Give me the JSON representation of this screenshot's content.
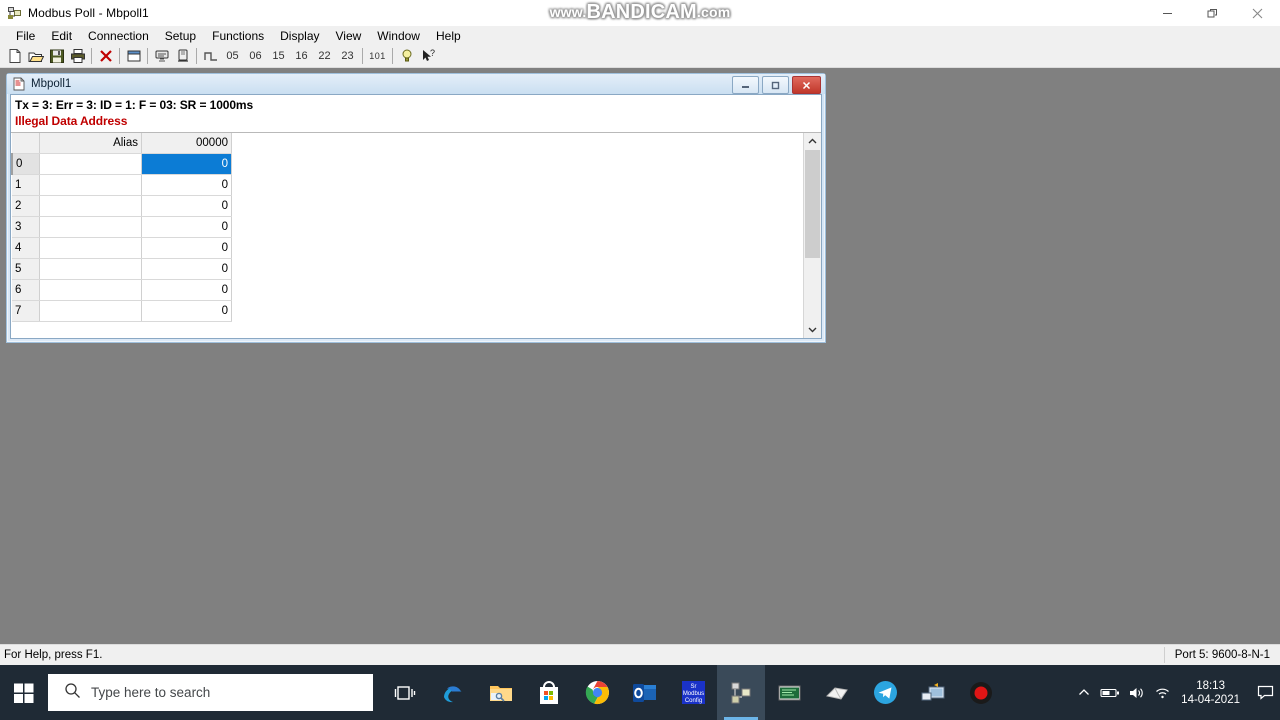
{
  "window": {
    "title": "Modbus Poll - Mbpoll1",
    "icon": "modbus-poll-app-icon",
    "caption_buttons": [
      {
        "name": "minimize",
        "glyph": "minimize-icon"
      },
      {
        "name": "restore",
        "glyph": "restore-icon"
      },
      {
        "name": "close",
        "glyph": "close-icon"
      }
    ]
  },
  "watermark": {
    "prefix": "www.",
    "main": "BANDICAM",
    "suffix": ".com"
  },
  "menu": {
    "items": [
      {
        "label": "File"
      },
      {
        "label": "Edit"
      },
      {
        "label": "Connection"
      },
      {
        "label": "Setup"
      },
      {
        "label": "Functions"
      },
      {
        "label": "Display"
      },
      {
        "label": "View"
      },
      {
        "label": "Window"
      },
      {
        "label": "Help"
      }
    ]
  },
  "toolbar": {
    "buttons": [
      {
        "name": "new-icon"
      },
      {
        "name": "open-icon"
      },
      {
        "name": "save-icon"
      },
      {
        "name": "print-icon"
      },
      {
        "name": "disconnect-icon"
      },
      {
        "name": "read-write-definition-icon"
      },
      {
        "name": "poll-definition-icon"
      },
      {
        "name": "communication-traffic-icon"
      },
      {
        "name": "pulse-icon"
      }
    ],
    "function_codes": [
      "05",
      "06",
      "15",
      "16",
      "22",
      "23"
    ],
    "decimal_button": "101",
    "help_button": "?",
    "context_help_button": "?"
  },
  "mdi_child": {
    "title": "Mbpoll1",
    "icon": "document-icon",
    "caption_buttons": [
      {
        "name": "minimize",
        "glyph": "minimize-icon"
      },
      {
        "name": "maximize",
        "glyph": "maximize-icon"
      },
      {
        "name": "close",
        "glyph": "close-icon"
      }
    ],
    "status_line": "Tx = 3: Err = 3: ID = 1: F = 03: SR = 1000ms",
    "error_line": "Illegal Data Address",
    "error_color": "#c00000",
    "selection_color": "#0c7cd5",
    "grid": {
      "headers": [
        "",
        "Alias",
        "00000"
      ],
      "rows": [
        {
          "index": "0",
          "alias": "",
          "value": "0",
          "selected": true
        },
        {
          "index": "1",
          "alias": "",
          "value": "0",
          "selected": false
        },
        {
          "index": "2",
          "alias": "",
          "value": "0",
          "selected": false
        },
        {
          "index": "3",
          "alias": "",
          "value": "0",
          "selected": false
        },
        {
          "index": "4",
          "alias": "",
          "value": "0",
          "selected": false
        },
        {
          "index": "5",
          "alias": "",
          "value": "0",
          "selected": false
        },
        {
          "index": "6",
          "alias": "",
          "value": "0",
          "selected": false
        },
        {
          "index": "7",
          "alias": "",
          "value": "0",
          "selected": false
        }
      ]
    }
  },
  "statusbar": {
    "help_text": "For Help, press F1.",
    "port_text": "Port 5: 9600-8-N-1"
  },
  "taskbar": {
    "start": "start-button",
    "search_placeholder": "Type here to search",
    "apps": [
      {
        "name": "task-view-icon"
      },
      {
        "name": "edge-icon"
      },
      {
        "name": "file-explorer-icon"
      },
      {
        "name": "microsoft-store-icon"
      },
      {
        "name": "chrome-icon"
      },
      {
        "name": "outlook-icon"
      },
      {
        "name": "modbus-config-icon"
      },
      {
        "name": "modbus-poll-icon"
      },
      {
        "name": "terminal-tool-icon"
      },
      {
        "name": "white-app-icon"
      },
      {
        "name": "telegram-icon"
      },
      {
        "name": "remote-desktop-icon"
      },
      {
        "name": "bandicam-record-icon"
      }
    ],
    "tray": {
      "show_hidden": "chevron-up-icon",
      "battery": "battery-icon",
      "volume": "volume-icon",
      "network": "wifi-icon",
      "time": "18:13",
      "date": "14-04-2021",
      "action_center": "action-center-icon"
    }
  }
}
